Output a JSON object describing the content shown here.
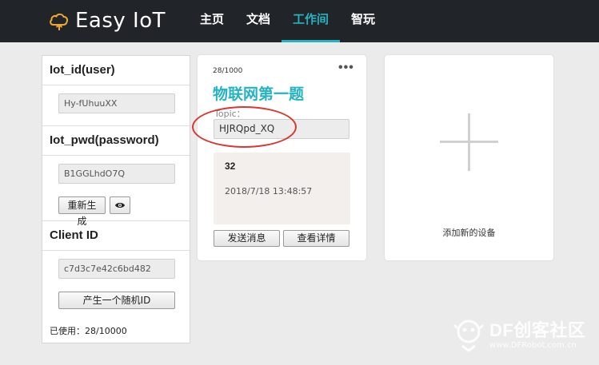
{
  "app": {
    "name": "Easy IoT",
    "brand_color": "#25b3c2",
    "logo_icon": "cloud-icon"
  },
  "nav": {
    "items": [
      {
        "label": "主页"
      },
      {
        "label": "文档"
      },
      {
        "label": "工作间",
        "active": true
      },
      {
        "label": "智玩"
      }
    ]
  },
  "credentials": {
    "user_title": "Iot_id(user)",
    "user_value": "Hy-fUhuuXX",
    "pwd_title": "Iot_pwd(password)",
    "pwd_value": "B1GGLhdO7Q",
    "regenerate_label": "重新生成",
    "toggle_visibility_icon": "eye-icon",
    "client_title": "Client ID",
    "client_value": "c7d3c7e42c6bd482",
    "random_id_label": "产生一个随机ID",
    "usage": "已使用：28/10000"
  },
  "device_card": {
    "count": "28/1000",
    "more": "•••",
    "title": "物联网第一题",
    "topic_label": "Topic：",
    "topic_value": "HJRQpd_XQ",
    "last_message": "32",
    "last_time": "2018/7/18 13:48:57",
    "send_label": "发送消息",
    "detail_label": "查看详情"
  },
  "add_card": {
    "label": "添加新的设备"
  },
  "watermark": {
    "brand": "DF创客社区",
    "url": "www.DFRobot.com.cn"
  },
  "annotation_color": "#d9372f"
}
